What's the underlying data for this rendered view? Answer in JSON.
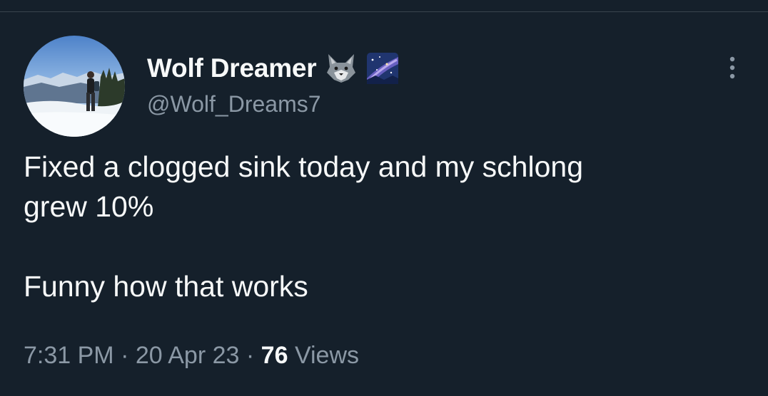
{
  "author": {
    "display_name": "Wolf Dreamer",
    "handle": "@Wolf_Dreams7",
    "name_emojis": [
      "wolf-emoji-icon",
      "milky-way-emoji-icon"
    ]
  },
  "tweet": {
    "text": "Fixed a clogged sink today and my schlong\ngrew 10%\n\nFunny how that works",
    "time": "7:31 PM",
    "date": "20 Apr 23",
    "separator": "·",
    "views_count": "76",
    "views_label": "Views"
  },
  "icons": {
    "more": "more-vertical-icon"
  },
  "colors": {
    "background": "#15202b",
    "primary_text": "#f7f9f9",
    "secondary_text": "#8b98a5",
    "divider": "#38444d"
  }
}
